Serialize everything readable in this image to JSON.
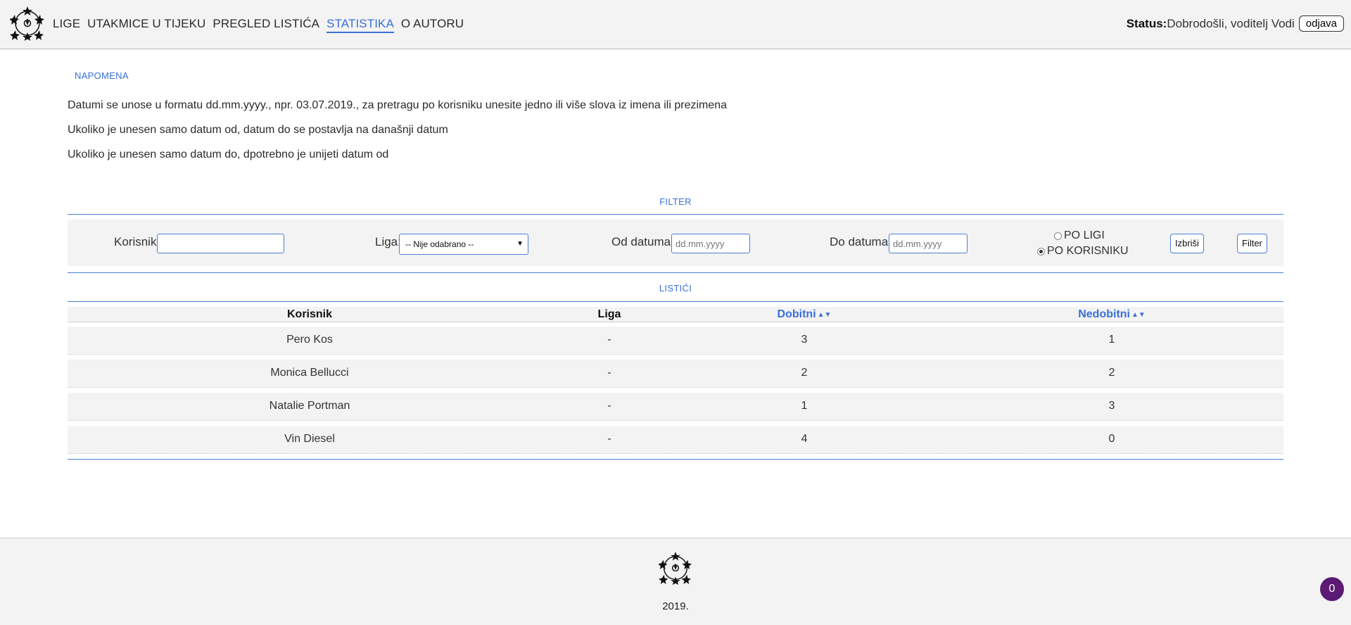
{
  "nav": {
    "items": [
      "LIGE",
      "UTAKMICE U TIJEKU",
      "PREGLED LISTIĆA",
      "STATISTIKA",
      "O AUTORU"
    ],
    "active": "STATISTIKA"
  },
  "status": {
    "label": "Status:",
    "text": "Dobrodošli, voditelj Vodi",
    "logout": "odjava"
  },
  "note": {
    "title": "NAPOMENA",
    "lines": [
      "Datumi se unose u formatu dd.mm.yyyy., npr. 03.07.2019., za pretragu po korisniku unesite jedno ili više slova iz imena ili prezimena",
      "Ukoliko je unesen samo datum od, datum do se postavlja na današnji datum",
      "Ukoliko je unesen samo datum do, dpotrebno je unijeti datum od"
    ]
  },
  "filter": {
    "title": "FILTER",
    "user_label": "Korisnik:",
    "user_value": "",
    "league_label": "Liga:",
    "league_selected": "-- Nije odabrano --",
    "from_label": "Od datuma:",
    "from_placeholder": "dd.mm.yyyy",
    "to_label": "Do datuma:",
    "to_placeholder": "dd.mm.yyyy",
    "radio_league": "PO LIGI",
    "radio_user": "PO KORISNIKU",
    "radio_selected": "PO KORISNIKU",
    "delete_btn": "Izbriši",
    "filter_btn": "Filter"
  },
  "slips": {
    "title": "LISTIĆI",
    "columns": [
      "Korisnik",
      "Liga",
      "Dobitni",
      "Nedobitni"
    ],
    "sort_icon": "sort-icon",
    "rows": [
      {
        "user": "Pero Kos",
        "league": "-",
        "wins": "3",
        "losses": "1"
      },
      {
        "user": "Monica Bellucci",
        "league": "-",
        "wins": "2",
        "losses": "2"
      },
      {
        "user": "Natalie Portman",
        "league": "-",
        "wins": "1",
        "losses": "3"
      },
      {
        "user": "Vin Diesel",
        "league": "-",
        "wins": "4",
        "losses": "0"
      }
    ]
  },
  "footer": {
    "year": "2019."
  },
  "badge": {
    "count": "0"
  },
  "colors": {
    "accent": "#3a6fd8",
    "background": "#f3f3f3",
    "badge": "#5b1a73"
  }
}
